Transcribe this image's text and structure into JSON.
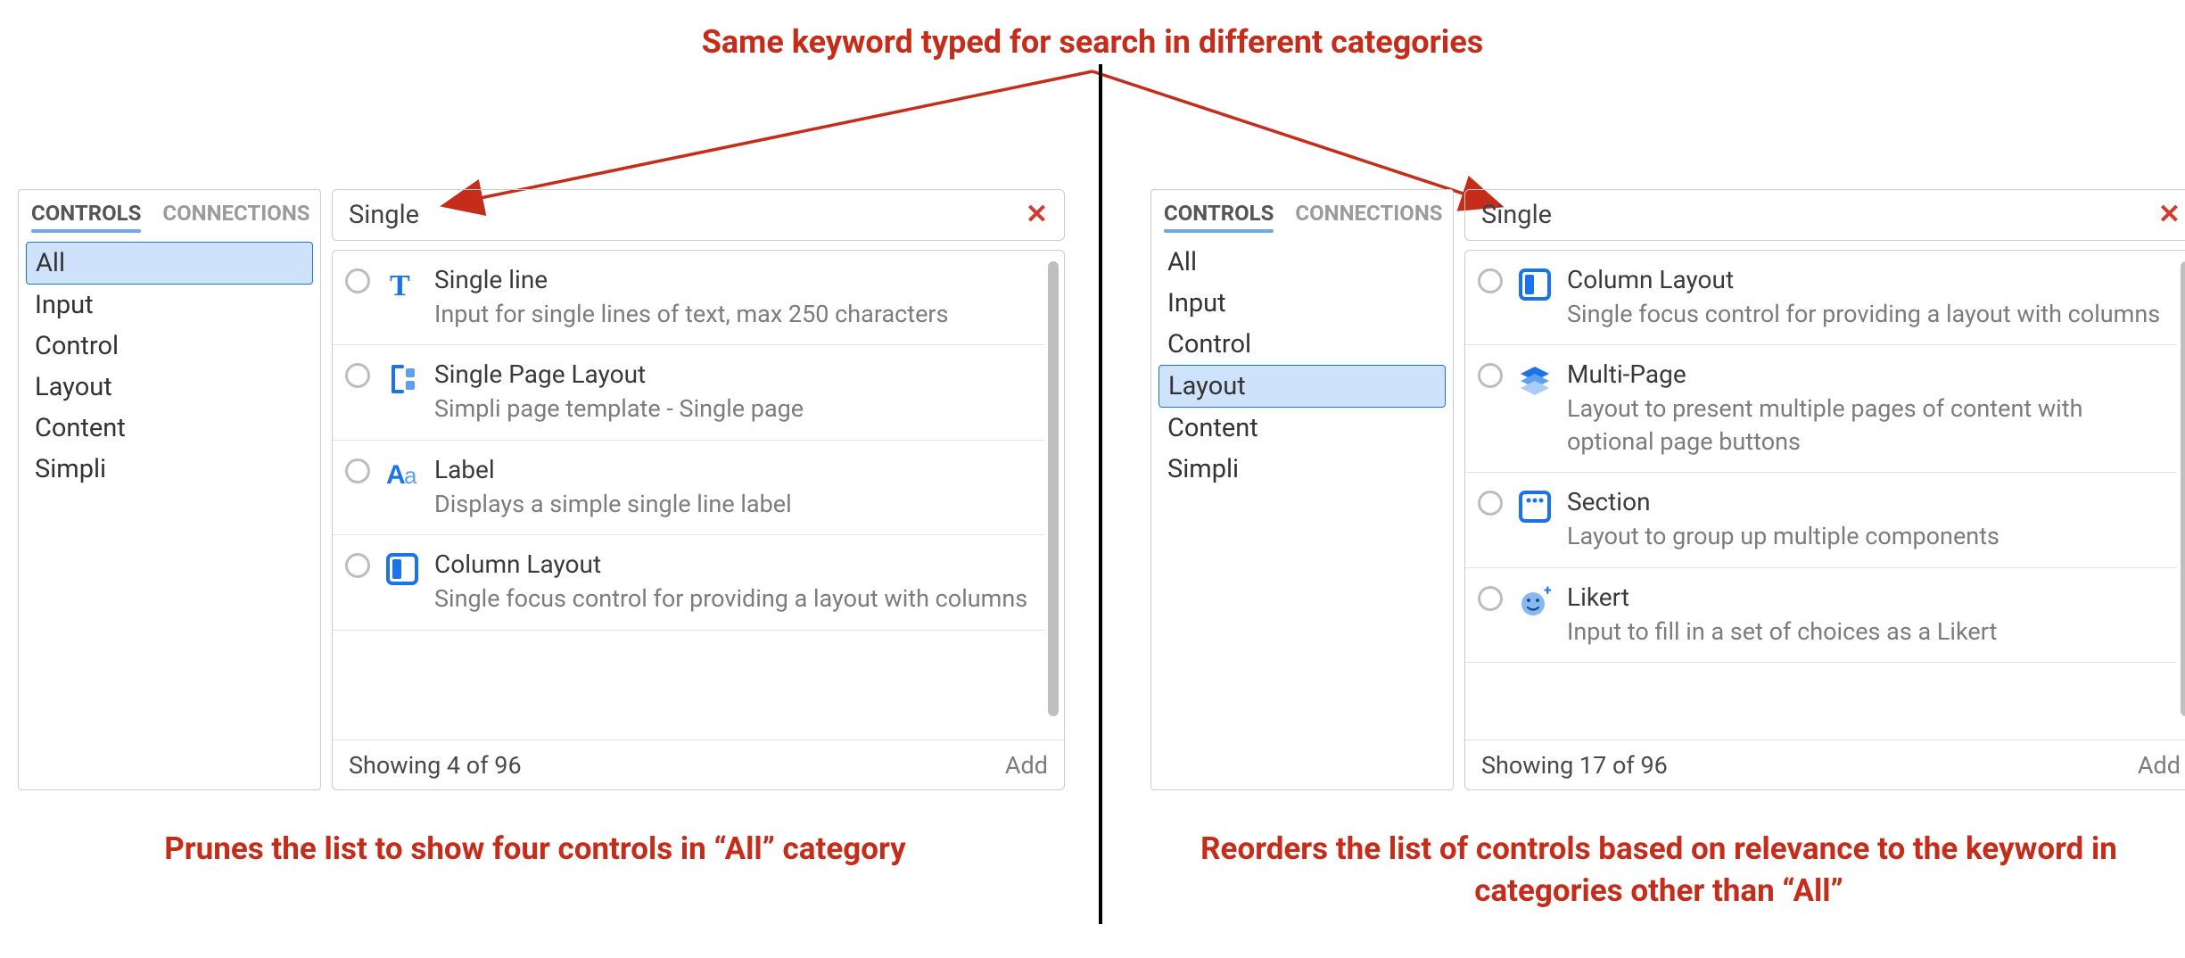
{
  "annotations": {
    "title": "Same keyword typed for search in different categories",
    "caption_left": "Prunes the list to show four controls in “All” category",
    "caption_right": "Reorders the list of controls based on relevance to the keyword in categories other than “All”"
  },
  "tabs": {
    "controls": "CONTROLS",
    "connections": "CONNECTIONS"
  },
  "categories": [
    "All",
    "Input",
    "Control",
    "Layout",
    "Content",
    "Simpli"
  ],
  "left": {
    "selected_category": "All",
    "search_value": "Single",
    "results": [
      {
        "icon": "text-icon",
        "title": "Single line",
        "desc": "Input for single lines of text, max 250 characters"
      },
      {
        "icon": "page-layout-icon",
        "title": "Single Page Layout",
        "desc": "Simpli page template - Single page"
      },
      {
        "icon": "label-icon",
        "title": "Label",
        "desc": "Displays a simple single line label"
      },
      {
        "icon": "column-layout-icon",
        "title": "Column Layout",
        "desc": "Single focus control for providing a layout with columns"
      }
    ],
    "footer_count": "Showing 4 of 96",
    "add_label": "Add"
  },
  "right": {
    "selected_category": "Layout",
    "search_value": "Single",
    "results": [
      {
        "icon": "column-layout-icon",
        "title": "Column Layout",
        "desc": "Single focus control for providing a layout with columns"
      },
      {
        "icon": "multipage-icon",
        "title": "Multi-Page",
        "desc": "Layout to present multiple pages of content with optional page buttons"
      },
      {
        "icon": "section-icon",
        "title": "Section",
        "desc": "Layout to group up multiple components"
      },
      {
        "icon": "likert-icon",
        "title": "Likert",
        "desc": "Input to fill in a set of choices as a Likert"
      }
    ],
    "footer_count": "Showing 17 of 96",
    "add_label": "Add"
  }
}
